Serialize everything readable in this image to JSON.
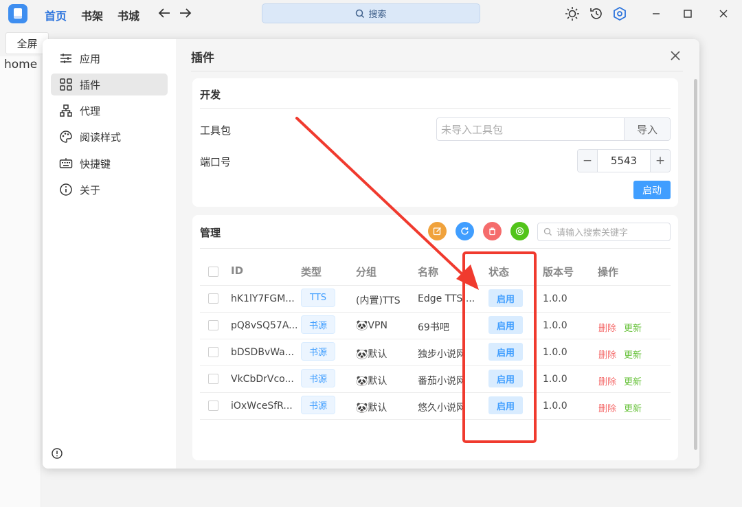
{
  "titlebar": {
    "nav": [
      "首页",
      "书架",
      "书城"
    ],
    "search_placeholder": "搜索"
  },
  "backpage": {
    "tab_label": "全屏",
    "home_text": "home"
  },
  "sidebar": {
    "items": [
      {
        "label": "应用",
        "icon": "sliders-icon"
      },
      {
        "label": "插件",
        "icon": "grid-icon"
      },
      {
        "label": "代理",
        "icon": "sitemap-icon"
      },
      {
        "label": "阅读样式",
        "icon": "palette-icon"
      },
      {
        "label": "快捷键",
        "icon": "keyboard-icon"
      },
      {
        "label": "关于",
        "icon": "info-icon"
      }
    ],
    "active_index": 1
  },
  "content": {
    "title": "插件"
  },
  "dev": {
    "title": "开发",
    "toolkit_label": "工具包",
    "toolkit_placeholder": "未导入工具包",
    "import_label": "导入",
    "port_label": "端口号",
    "port_value": "5543",
    "minus": "−",
    "plus": "+",
    "start_label": "启动"
  },
  "manage": {
    "title": "管理",
    "search_placeholder": "请输入搜索关键字",
    "action_colors": [
      "#f0a23c",
      "#409eff",
      "#f56c6c",
      "#52c41a"
    ],
    "columns": [
      "ID",
      "类型",
      "分组",
      "名称",
      "状态",
      "版本号",
      "操作"
    ],
    "rows": [
      {
        "id": "hK1lY7FGM...",
        "type": "TTS",
        "group": "(内置)TTS",
        "name": "Edge TTS ...",
        "status": "启用",
        "version": "1.0.0",
        "del": "",
        "upd": ""
      },
      {
        "id": "pQ8vSQ57A...",
        "type": "书源",
        "group": "🐼VPN",
        "name": "69书吧",
        "status": "启用",
        "version": "1.0.0",
        "del": "删除",
        "upd": "更新"
      },
      {
        "id": "bDSDBvWa...",
        "type": "书源",
        "group": "🐼默认",
        "name": "独步小说网",
        "status": "启用",
        "version": "1.0.0",
        "del": "删除",
        "upd": "更新"
      },
      {
        "id": "VkCbDrVco...",
        "type": "书源",
        "group": "🐼默认",
        "name": "番茄小说网",
        "status": "启用",
        "version": "1.0.0",
        "del": "删除",
        "upd": "更新"
      },
      {
        "id": "iOxWceSfR...",
        "type": "书源",
        "group": "🐼默认",
        "name": "悠久小说网",
        "status": "启用",
        "version": "1.0.0",
        "del": "删除",
        "upd": "更新"
      }
    ]
  },
  "annotation": {
    "color": "#f03a2e"
  }
}
